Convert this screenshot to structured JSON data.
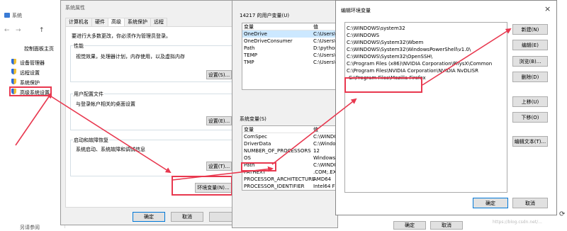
{
  "control_panel": {
    "title": "系统",
    "home_link": "控制面板主页",
    "links": [
      "设备管理器",
      "远程设置",
      "系统保护",
      "高级系统设置"
    ],
    "bottom_label": "另请参阅"
  },
  "sys_props": {
    "title": "系统属性",
    "tabs": [
      "计算机名",
      "硬件",
      "高级",
      "系统保护",
      "远程"
    ],
    "admin_notice": "要进行大多数更改，你必须作为管理员登录。",
    "perf_legend": "性能",
    "perf_desc": "视觉效果，处理器计划，内存使用，以及虚拟内存",
    "settings_label": "设置(S)...",
    "profile_legend": "用户配置文件",
    "profile_desc": "与登录帐户相关的桌面设置",
    "settings_e_label": "设置(E)...",
    "startup_legend": "启动和故障恢复",
    "startup_desc": "系统启动、系统故障和调试信息",
    "settings_t_label": "设置(T)...",
    "env_button": "环境变量(N)...",
    "ok": "确定",
    "cancel": "取消"
  },
  "env_vars": {
    "user_legend": "14217 的用户变量(U)",
    "col_var": "变量",
    "col_value": "值",
    "user_rows": [
      {
        "name": "OneDrive",
        "value": "C:\\Users\\1"
      },
      {
        "name": "OneDriveConsumer",
        "value": "C:\\Users\\1"
      },
      {
        "name": "Path",
        "value": "D:\\python"
      },
      {
        "name": "TEMP",
        "value": "C:\\Users\\1"
      },
      {
        "name": "TMP",
        "value": "C:\\Users\\1"
      }
    ],
    "sys_legend": "系统变量(S)",
    "sys_rows": [
      {
        "name": "ComSpec",
        "value": "C:\\WINDO"
      },
      {
        "name": "DriverData",
        "value": "C:\\Window"
      },
      {
        "name": "NUMBER_OF_PROCESSORS",
        "value": "12"
      },
      {
        "name": "OS",
        "value": "Windows_"
      },
      {
        "name": "Path",
        "value": "C:\\WINDO"
      },
      {
        "name": "PATHEXT",
        "value": ".COM;.EXE"
      },
      {
        "name": "PROCESSOR_ARCHITECTURE",
        "value": "AMD64"
      },
      {
        "name": "PROCESSOR_IDENTIFIER",
        "value": "Intel64 F"
      }
    ],
    "ok": "确定",
    "cancel": "取消"
  },
  "edit_env": {
    "title": "编辑环境变量",
    "close": "×",
    "entries": [
      "C:\\WINDOWS\\system32",
      "C:\\WINDOWS",
      "C:\\WINDOWS\\System32\\Wbem",
      "C:\\WINDOWS\\System32\\WindowsPowerShell\\v1.0\\",
      "C:\\WINDOWS\\System32\\OpenSSH\\",
      "C:\\Program Files (x86)\\NVIDIA Corporation\\PhysX\\Common",
      "C:\\Program Files\\NVIDIA Corporation\\NVIDIA NvDLISR",
      "C:\\Program Files\\Mozilla Firefox"
    ],
    "buttons": [
      "新建(N)",
      "编辑(E)",
      "浏览(B)...",
      "删除(D)",
      "上移(U)",
      "下移(O)",
      "编辑文本(T)..."
    ],
    "ok": "确定",
    "cancel": "取消"
  },
  "watermark": "https://blog.csdn.net/...",
  "accent": "#e8384f"
}
